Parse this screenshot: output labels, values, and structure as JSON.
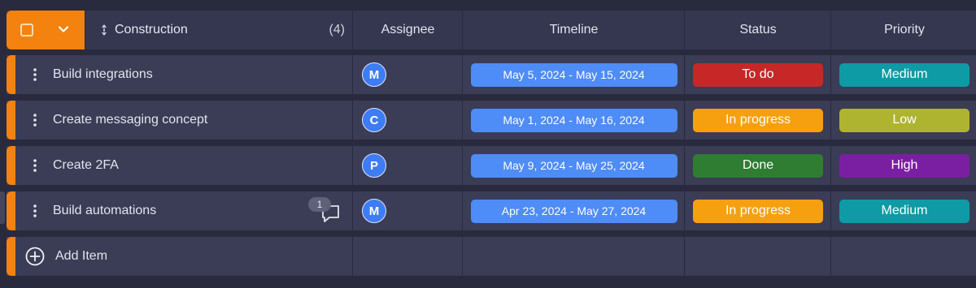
{
  "colors": {
    "accent": "#f4820f",
    "timeline": "#4e8cf7",
    "avatar": "#3d7cf2"
  },
  "header": {
    "group_name": "Construction",
    "group_count": "(4)",
    "columns": {
      "assignee": "Assignee",
      "timeline": "Timeline",
      "status": "Status",
      "priority": "Priority"
    }
  },
  "rows": [
    {
      "name": "Build integrations",
      "assignee": "M",
      "timeline": "May 5, 2024 - May 15, 2024",
      "status": "To do",
      "status_color": "#c62828",
      "priority": "Medium",
      "priority_color": "#0e9ba5"
    },
    {
      "name": "Create messaging concept",
      "assignee": "C",
      "timeline": "May 1, 2024 - May 16, 2024",
      "status": "In progress",
      "status_color": "#f7a00f",
      "priority": "Low",
      "priority_color": "#aeb42f"
    },
    {
      "name": "Create 2FA",
      "assignee": "P",
      "timeline": "May 9, 2024 - May 25, 2024",
      "status": "Done",
      "status_color": "#2e7d32",
      "priority": "High",
      "priority_color": "#7b1fa2"
    },
    {
      "name": "Build automations",
      "assignee": "M",
      "timeline": "Apr 23, 2024 - May 27, 2024",
      "status": "In progress",
      "status_color": "#f7a00f",
      "priority": "Medium",
      "priority_color": "#0e9ba5",
      "comment_count": "1"
    }
  ],
  "add_item_label": "Add Item"
}
